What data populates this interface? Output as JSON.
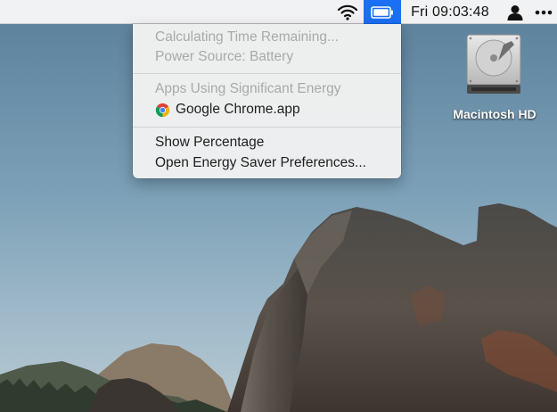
{
  "menubar": {
    "clock": "Fri 09:03:48",
    "icons": [
      "wifi-icon",
      "battery-icon",
      "user-icon",
      "more-icon"
    ],
    "highlight_color": "#1b6ff3"
  },
  "battery_menu": {
    "time_remaining": "Calculating Time Remaining...",
    "power_source": "Power Source: Battery",
    "apps_header": "Apps Using Significant Energy",
    "app_name": "Google Chrome.app",
    "show_percentage": "Show Percentage",
    "open_prefs": "Open Energy Saver Preferences..."
  },
  "desktop": {
    "drive_label": "Macintosh HD"
  }
}
